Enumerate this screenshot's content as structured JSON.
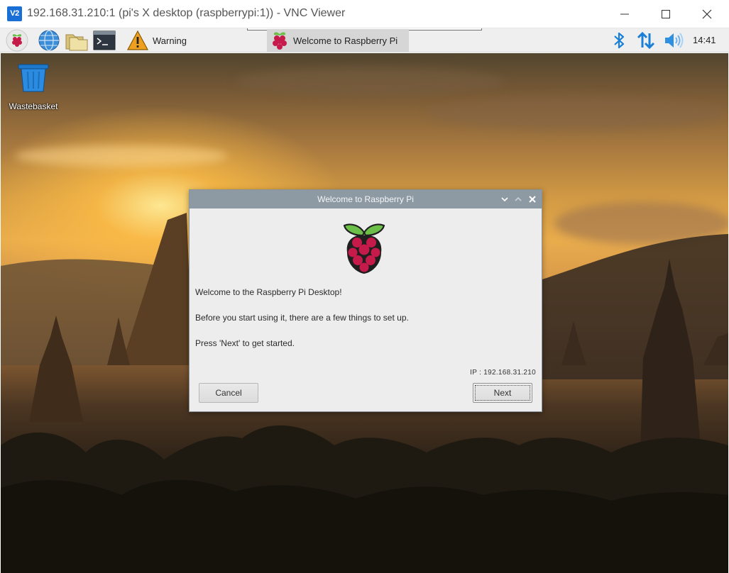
{
  "window": {
    "app_badge": "V2",
    "title": "192.168.31.210:1 (pi's X desktop (raspberrypi:1)) - VNC Viewer"
  },
  "panel": {
    "launchers": [
      {
        "icon": "raspberry-menu-icon"
      },
      {
        "icon": "web-browser-icon"
      },
      {
        "icon": "file-manager-icon"
      },
      {
        "icon": "terminal-icon"
      }
    ],
    "tasks": [
      {
        "label": "Warning",
        "icon": "warning-icon",
        "active": false
      },
      {
        "label": "Welcome to Raspberry Pi",
        "icon": "raspberry-icon",
        "active": true
      }
    ],
    "tray": {
      "bluetooth_icon": "bluetooth-icon",
      "network_icon": "network-icon",
      "volume_icon": "volume-icon",
      "clock": "14:41"
    }
  },
  "desktop": {
    "icons": [
      {
        "label": "Wastebasket",
        "icon": "wastebasket-icon"
      }
    ]
  },
  "dialog": {
    "title": "Welcome to Raspberry Pi",
    "line1": "Welcome to the Raspberry Pi Desktop!",
    "line2": "Before you start using it, there are a few things to set up.",
    "line3": "Press 'Next' to get started.",
    "ip": "IP : 192.168.31.210",
    "cancel_label": "Cancel",
    "next_label": "Next"
  },
  "colors": {
    "accent_blue": "#1a7fd6",
    "dialog_titlebar": "#8d9aa3",
    "raspberry_red": "#c51a4a",
    "leaf_green": "#6cc04a"
  }
}
